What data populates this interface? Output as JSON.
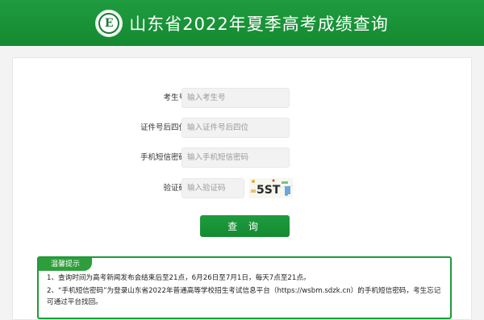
{
  "header": {
    "title": "山东省2022年夏季高考成绩查询",
    "logo_letter": "E"
  },
  "form": {
    "fields": [
      {
        "label": "考生号",
        "placeholder": "输入考生号"
      },
      {
        "label": "证件号后四位",
        "placeholder": "输入证件号后四位"
      },
      {
        "label": "手机短信密码",
        "placeholder": "输入手机短信密码"
      },
      {
        "label": "验证码",
        "placeholder": "输入验证码"
      }
    ],
    "captcha_text": "5ST",
    "submit_label": "查 询"
  },
  "tips": {
    "title": "温馨提示",
    "items": [
      "1、查询时间为高考新闻发布会结束后至21点，6月26日至7月1日，每天7点至21点。",
      "2、“手机短信密码”为登录山东省2022年普通高等学校招生考试信息平台（https://wsbm.sdzk.cn）的手机短信密码，考生忘记可通过平台找回。"
    ]
  },
  "colors": {
    "brand_green": "#1a9a3c",
    "page_bg": "#f3f3f3"
  }
}
